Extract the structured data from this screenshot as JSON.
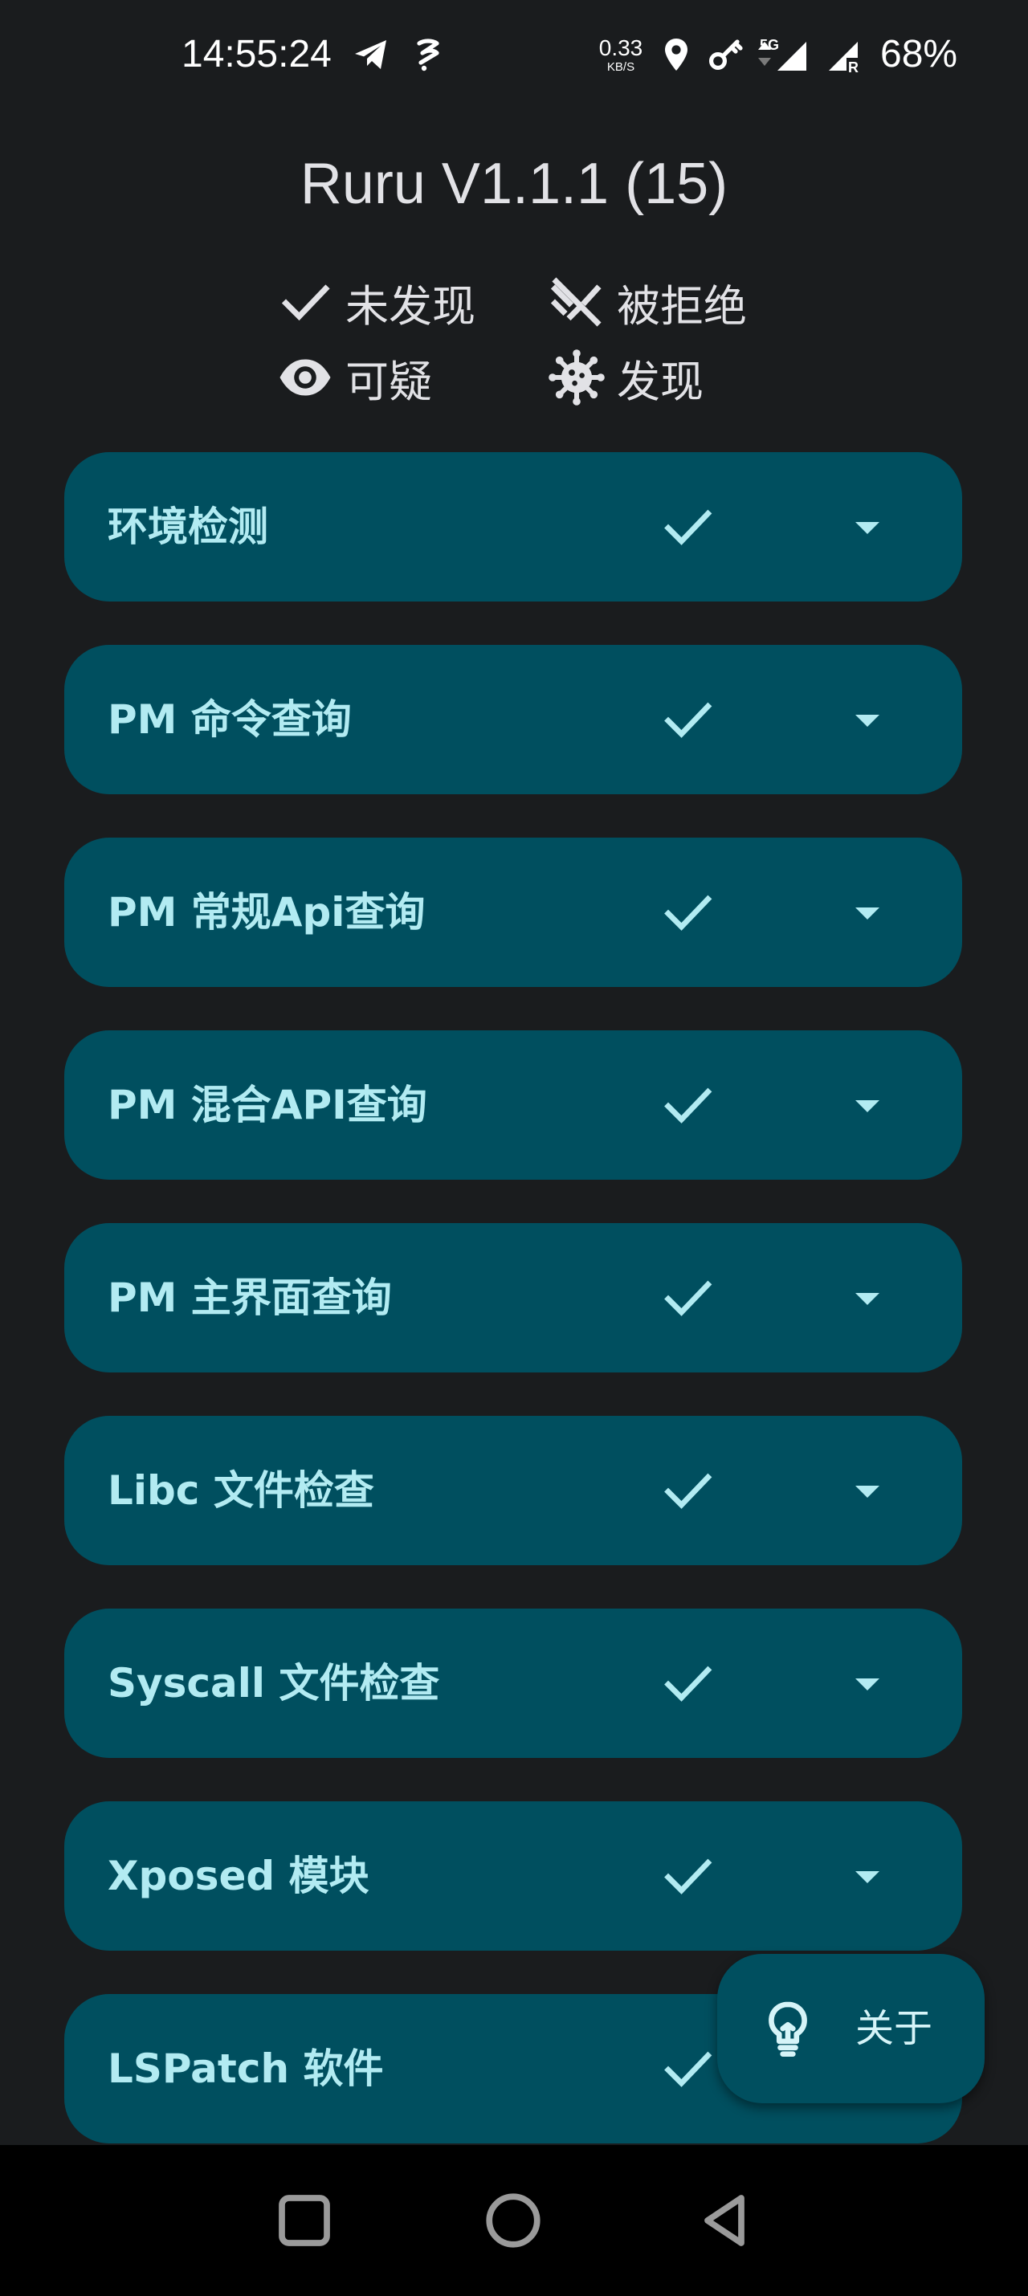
{
  "status_bar": {
    "time": "14:55:24",
    "net_speed_value": "0.33",
    "net_speed_unit": "KB/S",
    "network_type": "5G",
    "battery": "68%"
  },
  "app": {
    "title": "Ruru V1.1.1 (15)"
  },
  "legend": {
    "not_found": "未发现",
    "denied": "被拒绝",
    "suspicious": "可疑",
    "found": "发现"
  },
  "checks": [
    {
      "title": "环境检测",
      "status_icon": "check-icon",
      "expand_icon": "arrow-drop-down-icon"
    },
    {
      "title": "PM 命令查询",
      "status_icon": "check-icon",
      "expand_icon": "arrow-drop-down-icon"
    },
    {
      "title": "PM 常规Api查询",
      "status_icon": "check-icon",
      "expand_icon": "arrow-drop-down-icon"
    },
    {
      "title": "PM 混合API查询",
      "status_icon": "check-icon",
      "expand_icon": "arrow-drop-down-icon"
    },
    {
      "title": "PM 主界面查询",
      "status_icon": "check-icon",
      "expand_icon": "arrow-drop-down-icon"
    },
    {
      "title": "Libc 文件检查",
      "status_icon": "check-icon",
      "expand_icon": "arrow-drop-down-icon"
    },
    {
      "title": "Syscall 文件检查",
      "status_icon": "check-icon",
      "expand_icon": "arrow-drop-down-icon"
    },
    {
      "title": "Xposed 模块",
      "status_icon": "check-icon",
      "expand_icon": "arrow-drop-down-icon"
    },
    {
      "title": "LSPatch 软件",
      "status_icon": "check-icon",
      "expand_icon": "arrow-drop-down-icon"
    }
  ],
  "fab": {
    "label": "关于",
    "icon": "lightbulb-icon"
  },
  "colors": {
    "background": "#1a1c1e",
    "card": "#004f5f",
    "card_text": "#b2ebf2",
    "nav_bar": "#000000"
  }
}
